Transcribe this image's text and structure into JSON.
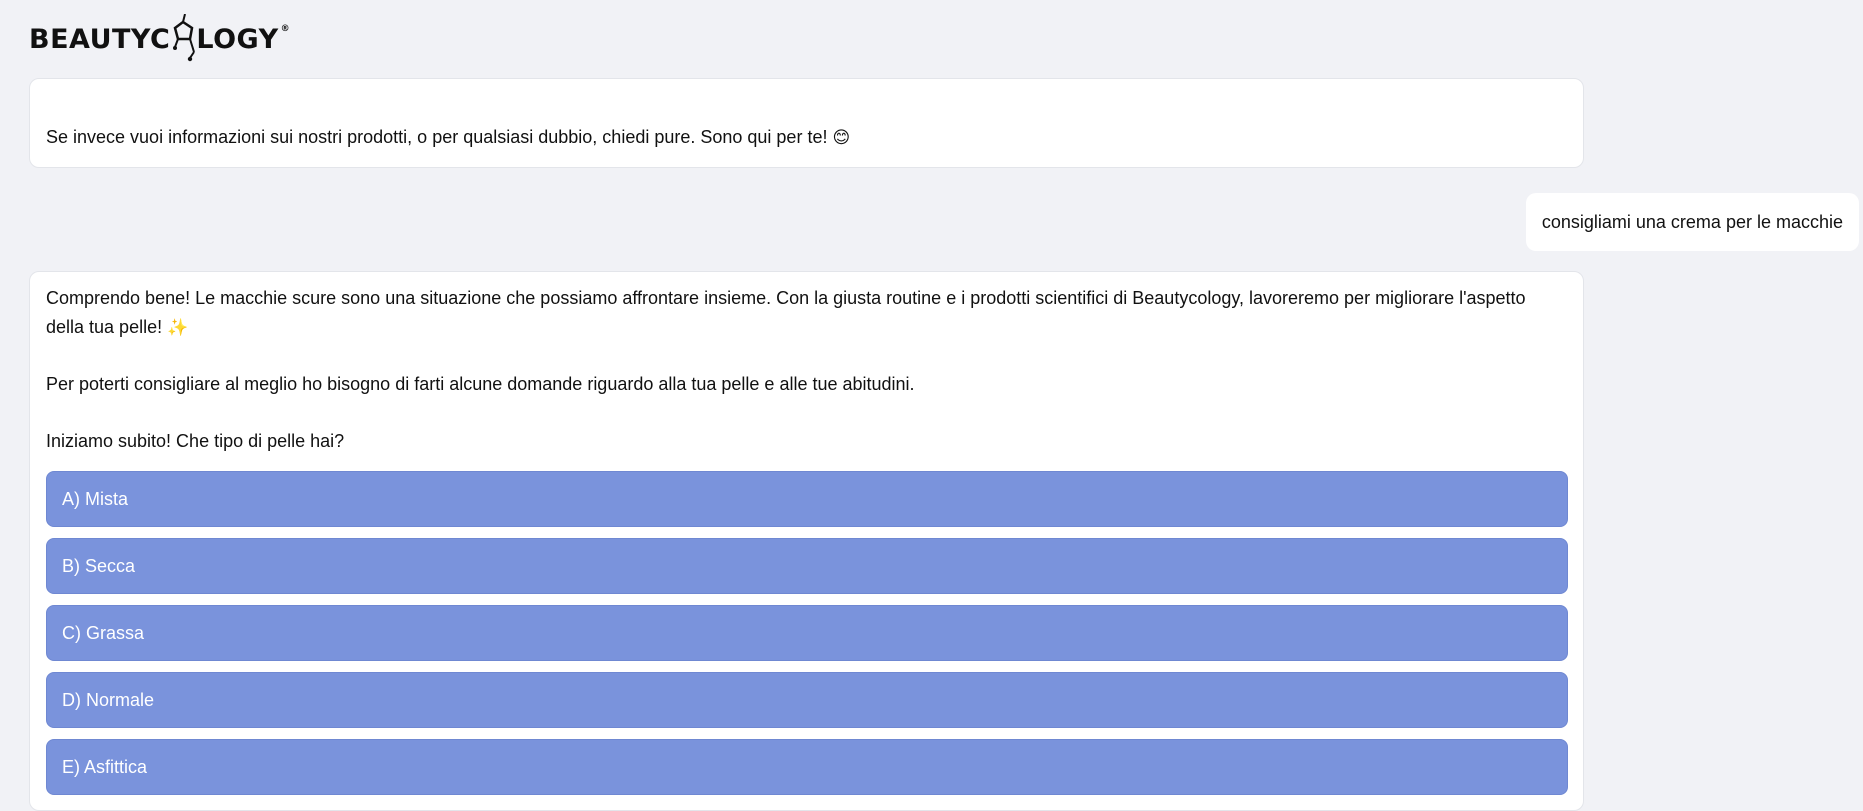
{
  "header": {
    "logo_text_left": "BEAUTYC",
    "logo_text_right": "LOGY",
    "logo_mark": "®",
    "logo_icon": "molecule-icon"
  },
  "messages": {
    "bot_1": {
      "text": "Se invece vuoi informazioni sui nostri prodotti, o per qualsiasi dubbio, chiedi pure. Sono qui per te!",
      "emoji": "😊"
    },
    "user_1": {
      "text": "consigliami una crema per le macchie"
    },
    "bot_2": {
      "paragraph_1": "Comprendo bene! Le macchie scure sono una situazione che possiamo affrontare insieme. Con la giusta routine e i prodotti scientifici di Beautycology, lavoreremo per migliorare l'aspetto della tua pelle!",
      "paragraph_1_emoji": "✨",
      "paragraph_2": "Per poterti consigliare al meglio ho bisogno di farti alcune domande riguardo alla tua pelle e alle tue abitudini.",
      "paragraph_3": "Iniziamo subito! Che tipo di pelle hai?",
      "options": [
        {
          "label": "A) Mista"
        },
        {
          "label": "B) Secca"
        },
        {
          "label": "C) Grassa"
        },
        {
          "label": "D) Normale"
        },
        {
          "label": "E) Asfittica"
        }
      ]
    }
  },
  "colors": {
    "background": "#f1f2f6",
    "option_button": "#7a93dc",
    "bubble": "#ffffff"
  }
}
